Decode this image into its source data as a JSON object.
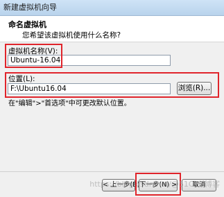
{
  "window": {
    "title": "新建虚拟机向导"
  },
  "header": {
    "title": "命名虚拟机",
    "subtitle": "您希望该虚拟机使用什么名称?"
  },
  "name_field": {
    "label": "虚拟机名称(V):",
    "value": "Ubuntu-16.04"
  },
  "location_field": {
    "label": "位置(L):",
    "value": "F:\\Ubuntu16.04",
    "browse_label": "浏览(R)..."
  },
  "hint": "在\"编辑\">\"首选项\"中可更改默认位置。",
  "footer": {
    "back_label": "< 上一步(B)",
    "next_label": "下一步(N) >",
    "cancel_label": "取消"
  },
  "watermark": "https://blog.csdn.net/@51CTO博客",
  "colors": {
    "highlight": "#e0242b"
  }
}
